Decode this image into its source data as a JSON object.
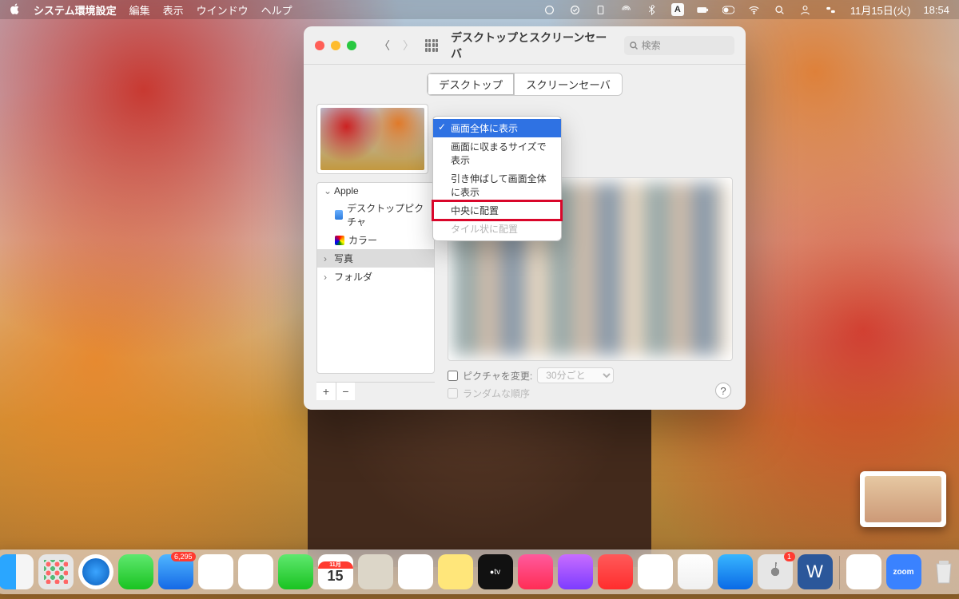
{
  "menubar": {
    "app": "システム環境設定",
    "items": [
      "編集",
      "表示",
      "ウインドウ",
      "ヘルプ"
    ],
    "date": "11月15日(火)",
    "time": "18:54"
  },
  "window": {
    "title": "デスクトップとスクリーンセーバ",
    "search_placeholder": "検索",
    "tabs": {
      "desktop": "デスクトップ",
      "screensaver": "スクリーンセーバ"
    },
    "tree": {
      "section0": "Apple",
      "item0": "デスクトップピクチャ",
      "item1": "カラー",
      "section1": "写真",
      "section2": "フォルダ"
    },
    "options": {
      "change": "ピクチャを変更:",
      "interval": "30分ごと",
      "random": "ランダムな順序"
    }
  },
  "dropdown": {
    "o0": "画面全体に表示",
    "o1": "画面に収まるサイズで表示",
    "o2": "引き伸ばして画面全体に表示",
    "o3": "中央に配置",
    "o4": "タイル状に配置"
  },
  "dock": {
    "mail_badge": "6,295",
    "pref_badge": "1",
    "cal_month": "11月",
    "cal_day": "15",
    "tv": "tv",
    "zoom": "zoom"
  }
}
